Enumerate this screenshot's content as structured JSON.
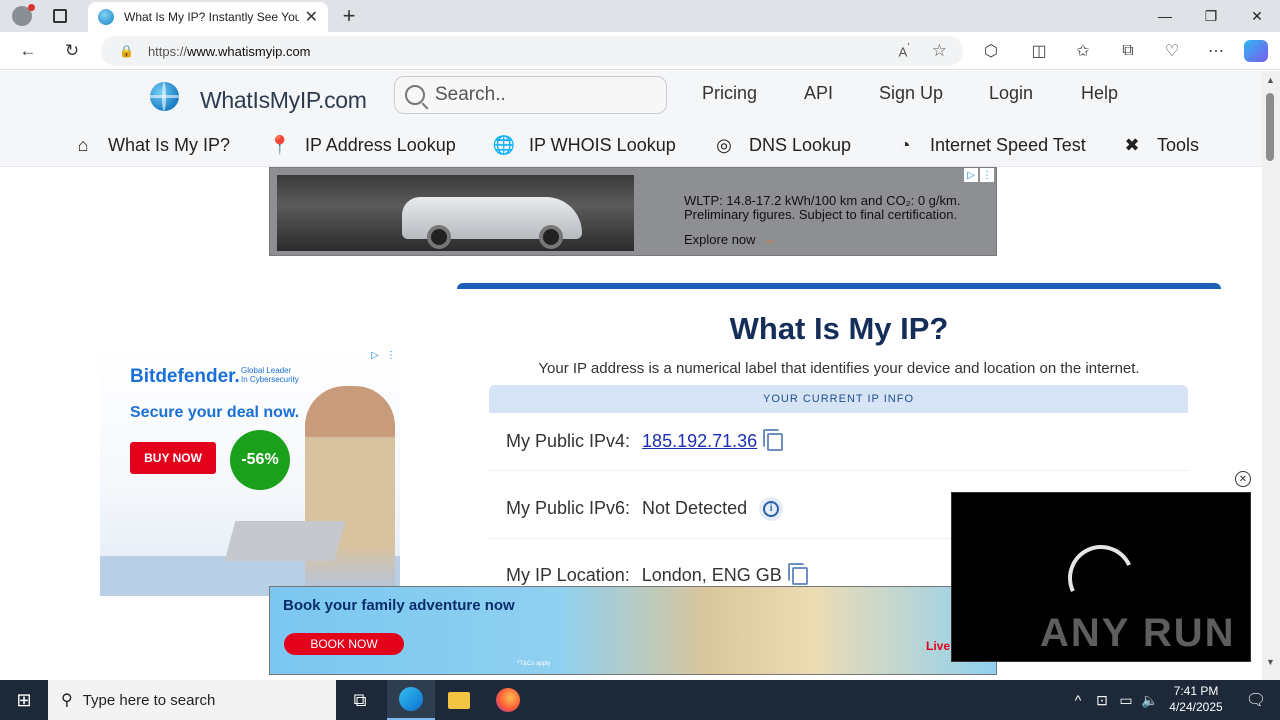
{
  "browser": {
    "tab_title": "What Is My IP? Instantly See Your",
    "url_prefix": "https://",
    "url_host": "www.whatismyip.com"
  },
  "site": {
    "logo_text": "WhatIsMyIP.com",
    "search_placeholder": "Search..",
    "top_links": [
      "Pricing",
      "API",
      "Sign Up",
      "Login",
      "Help"
    ],
    "main_nav": [
      "What Is My IP?",
      "IP Address Lookup",
      "IP WHOIS Lookup",
      "DNS Lookup",
      "Internet Speed Test",
      "Tools"
    ]
  },
  "ads": {
    "banner_top": {
      "line1": "WLTP: 14.8-17.2 kWh/100 km and CO₂: 0 g/km.",
      "line2": "Preliminary figures. Subject to final certification.",
      "cta": "Explore now",
      "arrow": "→"
    },
    "side": {
      "brand": "Bitdefender.",
      "tagline1": "Global Leader",
      "tagline2": "In Cybersecurity",
      "headline": "Secure your deal now.",
      "button": "BUY NOW",
      "discount": "-56%"
    },
    "bottom": {
      "headline": "Book your family adventure now",
      "button": "BOOK NOW",
      "fine_print": "*T&Cs apply",
      "corner": "Live"
    },
    "video_watermark": "ANY  RUN"
  },
  "card": {
    "title": "What Is My IP?",
    "subtitle": "Your IP address is a numerical label that identifies your device and location on the internet.",
    "header": "YOUR CURRENT IP INFO",
    "rows": [
      {
        "label": "My Public IPv4:",
        "value": "185.192.71.36"
      },
      {
        "label": "My Public IPv6:",
        "value": "Not Detected"
      },
      {
        "label": "My IP Location:",
        "value": "London, ENG GB"
      }
    ]
  },
  "taskbar": {
    "search_placeholder": "Type here to search",
    "time": "7:41 PM",
    "date": "4/24/2025"
  }
}
